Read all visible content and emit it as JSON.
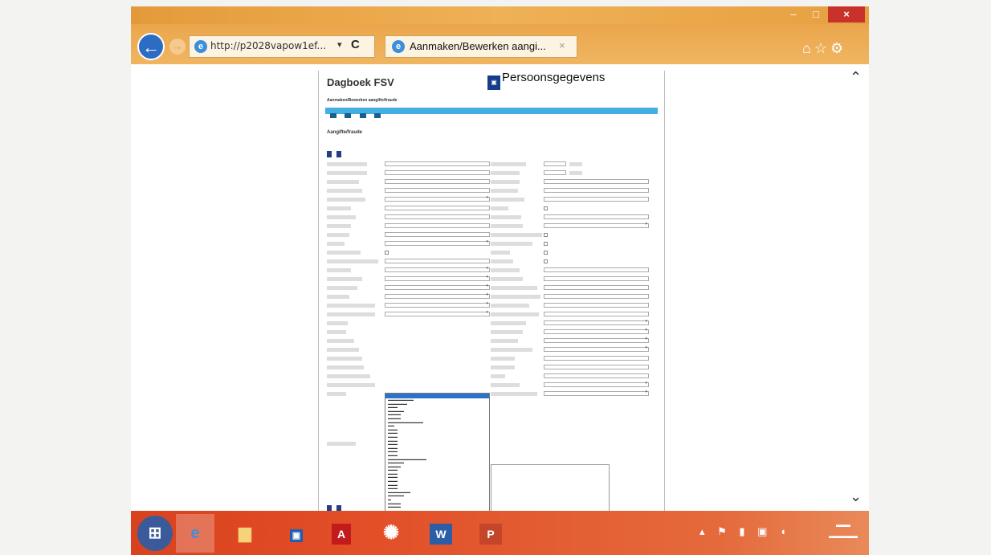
{
  "browser": {
    "url": "http://p2028vapow1ef...",
    "tab_title": "Aanmaken/Bewerken aangi...",
    "tab_close": "×",
    "back_symbol": "←",
    "refresh_symbol": "C",
    "dropdown_symbol": "▾",
    "window_minimize": "–",
    "window_maximize": "□",
    "window_close": "×",
    "toolbar_icons": "⌂☆⚙"
  },
  "page": {
    "app_title": "Dagboek FSV",
    "header_title": "Persoonsgegevens",
    "breadcrumb": "Aanmaken/Bewerken aangifte/fraude",
    "section_title": "Aangifte/fraude"
  },
  "scroll": {
    "up": "⌃",
    "down": "⌄"
  },
  "taskbar": {
    "word_label": "W",
    "ppt_label": "P",
    "pdf_label": "A",
    "app_label": "▣"
  }
}
